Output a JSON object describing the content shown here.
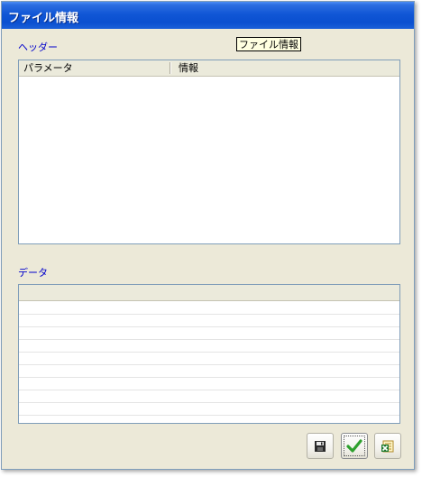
{
  "window": {
    "title": "ファイル情報"
  },
  "header_section": {
    "label": "ヘッダー",
    "info_tag": "ファイル情報",
    "columns": [
      "パラメータ",
      "情報"
    ]
  },
  "data_section": {
    "label": "データ"
  },
  "buttons": {
    "save_icon": "floppy-disk-icon",
    "ok_icon": "checkmark-icon",
    "excel_icon": "excel-export-icon"
  },
  "colors": {
    "title_bar": "#0a4fd0",
    "label_blue": "#0000cc",
    "window_bg": "#ece9d8",
    "check_green": "#2ea02e"
  }
}
